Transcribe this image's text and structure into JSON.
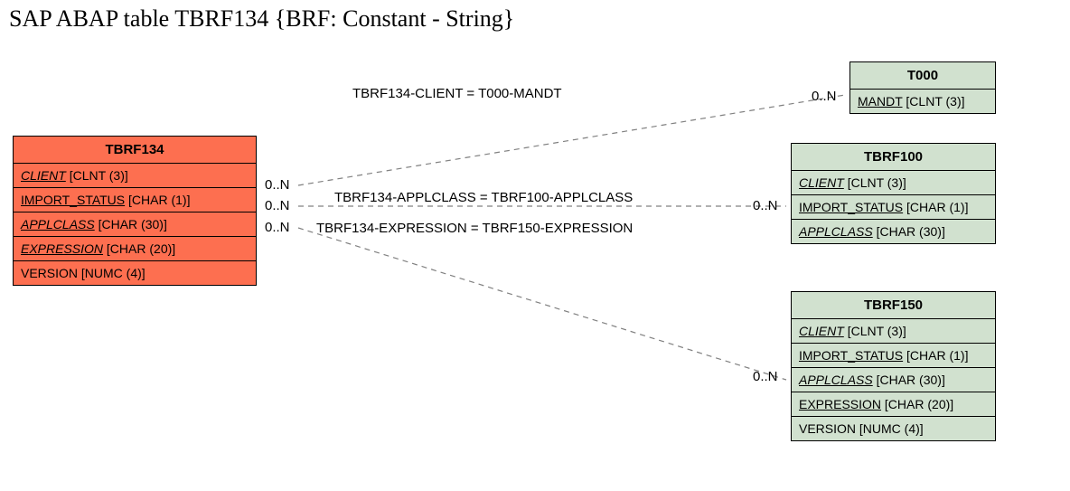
{
  "title": "SAP ABAP table TBRF134 {BRF: Constant - String}",
  "mainEntity": {
    "name": "TBRF134",
    "fields": [
      {
        "name": "CLIENT",
        "type": "[CLNT (3)]",
        "underline": true,
        "italic": true
      },
      {
        "name": "IMPORT_STATUS",
        "type": "[CHAR (1)]",
        "underline": true,
        "italic": false
      },
      {
        "name": "APPLCLASS",
        "type": "[CHAR (30)]",
        "underline": true,
        "italic": true
      },
      {
        "name": "EXPRESSION",
        "type": "[CHAR (20)]",
        "underline": true,
        "italic": true
      },
      {
        "name": "VERSION",
        "type": "[NUMC (4)]",
        "underline": false,
        "italic": false
      }
    ]
  },
  "relations": [
    {
      "label": "TBRF134-CLIENT = T000-MANDT",
      "leftCard": "0..N",
      "rightCard": "0..N"
    },
    {
      "label": "TBRF134-APPLCLASS = TBRF100-APPLCLASS",
      "leftCard": "0..N",
      "rightCard": "0..N"
    },
    {
      "label": "TBRF134-EXPRESSION = TBRF150-EXPRESSION",
      "leftCard": "0..N",
      "rightCard": "0..N"
    }
  ],
  "targets": [
    {
      "name": "T000",
      "fields": [
        {
          "name": "MANDT",
          "type": "[CLNT (3)]",
          "underline": true,
          "italic": false
        }
      ]
    },
    {
      "name": "TBRF100",
      "fields": [
        {
          "name": "CLIENT",
          "type": "[CLNT (3)]",
          "underline": true,
          "italic": true
        },
        {
          "name": "IMPORT_STATUS",
          "type": "[CHAR (1)]",
          "underline": true,
          "italic": false
        },
        {
          "name": "APPLCLASS",
          "type": "[CHAR (30)]",
          "underline": true,
          "italic": true
        }
      ]
    },
    {
      "name": "TBRF150",
      "fields": [
        {
          "name": "CLIENT",
          "type": "[CLNT (3)]",
          "underline": true,
          "italic": true
        },
        {
          "name": "IMPORT_STATUS",
          "type": "[CHAR (1)]",
          "underline": true,
          "italic": false
        },
        {
          "name": "APPLCLASS",
          "type": "[CHAR (30)]",
          "underline": true,
          "italic": true
        },
        {
          "name": "EXPRESSION",
          "type": "[CHAR (20)]",
          "underline": true,
          "italic": false
        },
        {
          "name": "VERSION",
          "type": "[NUMC (4)]",
          "underline": false,
          "italic": false
        }
      ]
    }
  ]
}
